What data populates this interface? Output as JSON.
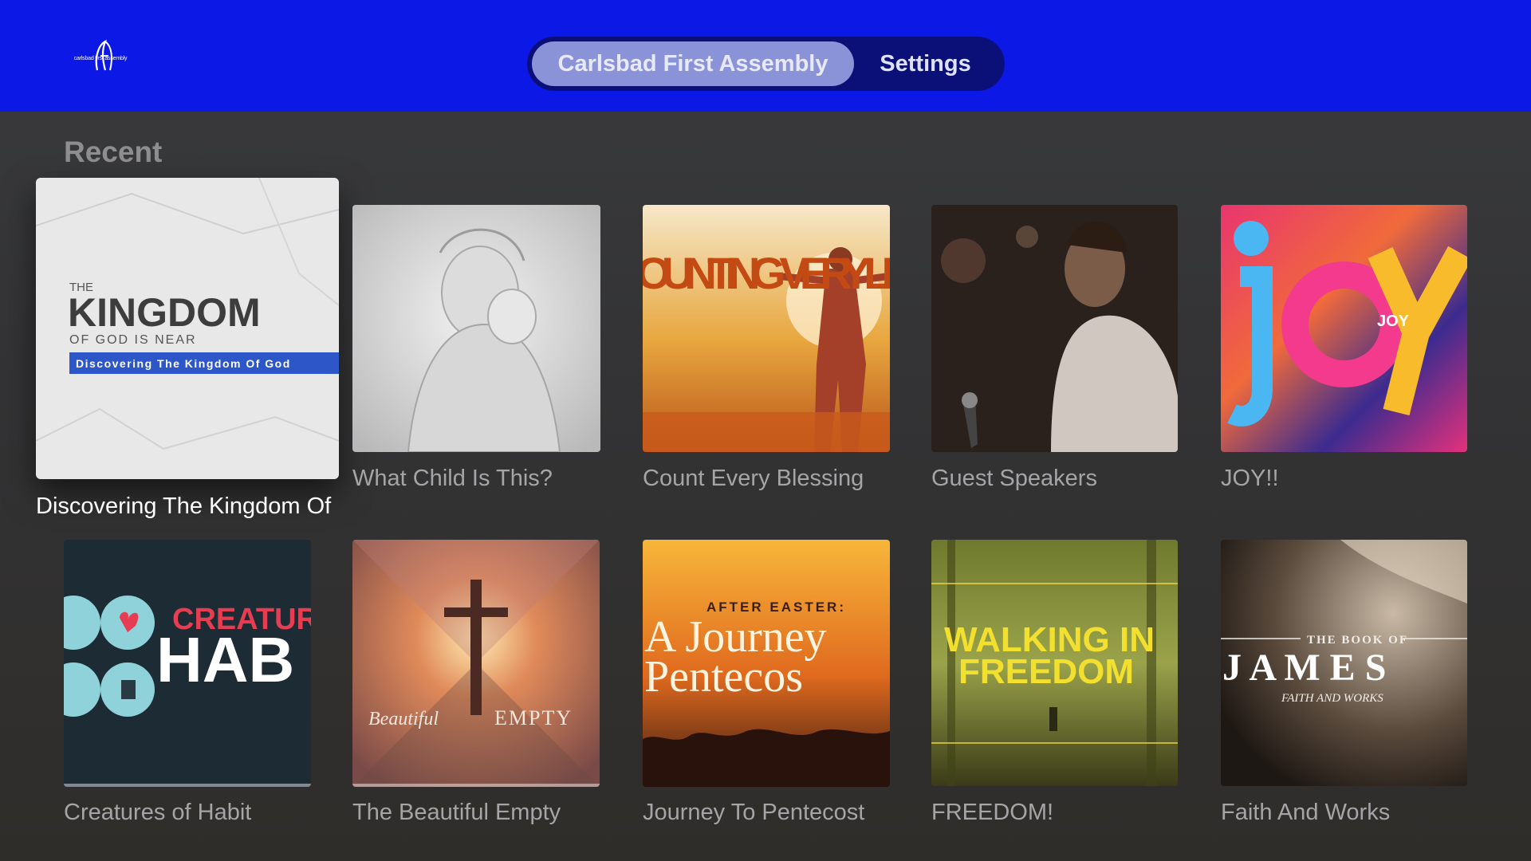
{
  "app": {
    "logo": {
      "icon": "church-logo-icon",
      "text": "carlsbad first assembly"
    },
    "nav": {
      "tabs": [
        {
          "label": "Carlsbad First Assembly",
          "active": true
        },
        {
          "label": "Settings",
          "active": false
        }
      ]
    },
    "colors": {
      "header_bg": "#0c19e6",
      "nav_bg": "#0b1078",
      "nav_active": "#8b93d8",
      "page_bg": "#38393b"
    }
  },
  "section": {
    "title": "Recent",
    "items": [
      {
        "label": "Discovering The Kingdom Of God",
        "art": {
          "pre": "THE",
          "title": "KINGDOM",
          "sub": "OF GOD IS NEAR",
          "banner": "Discovering The Kingdom Of God"
        },
        "focused": true
      },
      {
        "label": "What Child Is This?",
        "art": {}
      },
      {
        "label": "Count Every Blessing",
        "art": {
          "title": "OUNTING VERY LESSING"
        }
      },
      {
        "label": "Guest Speakers",
        "art": {}
      },
      {
        "label": "JOY!!",
        "art": {
          "title": "joy",
          "sub": "JOY"
        }
      },
      {
        "label": "Creatures of Habit",
        "art": {
          "title": "CREATUR",
          "sub": "HAB"
        }
      },
      {
        "label": "The Beautiful Empty",
        "art": {
          "title": "Beautiful",
          "sub": "EMPTY"
        }
      },
      {
        "label": "Journey To Pentecost",
        "art": {
          "pre": "AFTER EASTER:",
          "title": "A Journey",
          "sub": "Pentecos"
        }
      },
      {
        "label": "FREEDOM!",
        "art": {
          "title": "WALKING IN",
          "sub": "FREEDOM"
        }
      },
      {
        "label": "Faith And Works",
        "art": {
          "pre": "THE BOOK OF",
          "title": "J A M E S",
          "sub": "FAITH AND WORKS"
        }
      }
    ]
  }
}
